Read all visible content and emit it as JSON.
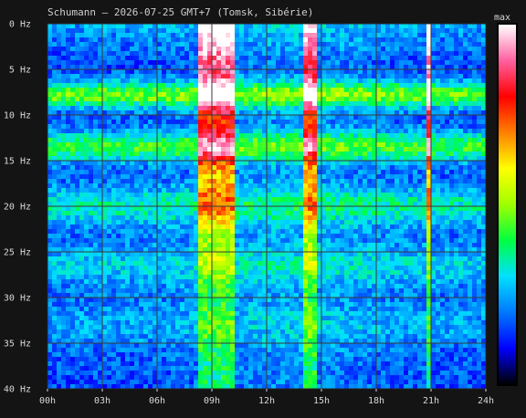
{
  "chart_data": {
    "type": "heatmap",
    "title": "Schumann — 2026-07-25 GMT+7  (Tomsk, Sibérie)",
    "x_tick_labels": [
      "00h",
      "03h",
      "06h",
      "09h",
      "12h",
      "15h",
      "18h",
      "21h",
      "24h"
    ],
    "x_ticks_hours": [
      0,
      3,
      6,
      9,
      12,
      15,
      18,
      21,
      24
    ],
    "y_tick_labels": [
      "0 Hz",
      "5 Hz",
      "10 Hz",
      "15 Hz",
      "20 Hz",
      "25 Hz",
      "30 Hz",
      "35 Hz",
      "40 Hz"
    ],
    "y_ticks_hz": [
      0,
      5,
      10,
      15,
      20,
      25,
      30,
      35,
      40
    ],
    "xlim_hours": [
      0,
      24
    ],
    "ylim_hz": [
      0,
      40
    ],
    "y_inverted": true,
    "grid": true,
    "colorbar": {
      "label": "max",
      "position": "right",
      "colors": [
        "#000000",
        "#0000ff",
        "#0078ff",
        "#00e0ff",
        "#00ff40",
        "#a0ff00",
        "#ffff00",
        "#ff8000",
        "#ff0000",
        "#ff60a0",
        "#ffffff"
      ]
    },
    "resonance_bands_hz": [
      7.8,
      13.5,
      20,
      26.5,
      33
    ],
    "bright_intervals_hours": [
      [
        8.4,
        10.2
      ],
      [
        14.1,
        14.8
      ],
      [
        20.9,
        21.0
      ]
    ],
    "colors": {
      "background": "#141414",
      "grid": "#3a3a3a",
      "text": "#d8d8d8",
      "title": "#cfcfcf",
      "frame": "#bdbdbd"
    }
  }
}
